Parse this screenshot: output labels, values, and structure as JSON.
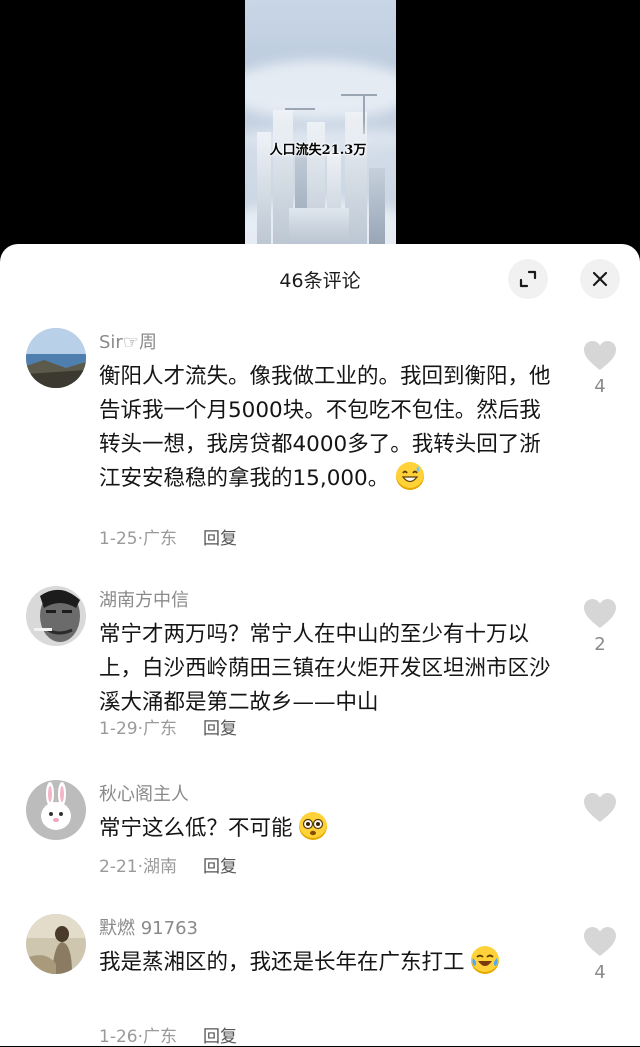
{
  "video": {
    "overlay_text": "人口流失21.3万"
  },
  "comments_panel": {
    "title": "46条评论",
    "expand_icon": "expand-icon",
    "close_icon": "close-icon",
    "comments": [
      {
        "username": "Sir☞周",
        "text": "衡阳人才流失。像我做工业的。我回到衡阳，他告诉我一个月5000块。不包吃不包住。然后我转头一想，我房贷都4000多了。我转头回了浙江安安稳稳的拿我的15,000。",
        "emoji": "grinning-sweat-emoji",
        "date": "1-25",
        "location": "广东",
        "reply_label": "回复",
        "like_count": "4"
      },
      {
        "username": "湖南方中信",
        "text": "常宁才两万吗？常宁人在中山的至少有十万以上，白沙西岭荫田三镇在火炬开发区坦洲市区沙溪大涌都是第二故乡——中山",
        "date": "1-29",
        "location": "广东",
        "reply_label": "回复",
        "like_count": "2"
      },
      {
        "username": "秋心阁主人",
        "text": "常宁这么低？不可能",
        "emoji": "flushed-emoji",
        "date": "2-21",
        "location": "湖南",
        "reply_label": "回复",
        "like_count": ""
      },
      {
        "username": "默燃 91763",
        "text": "我是蒸湘区的，我还是长年在广东打工",
        "emoji": "tears-of-joy-emoji",
        "date": "1-26",
        "location": "广东",
        "reply_label": "回复",
        "like_count": "4"
      }
    ]
  }
}
